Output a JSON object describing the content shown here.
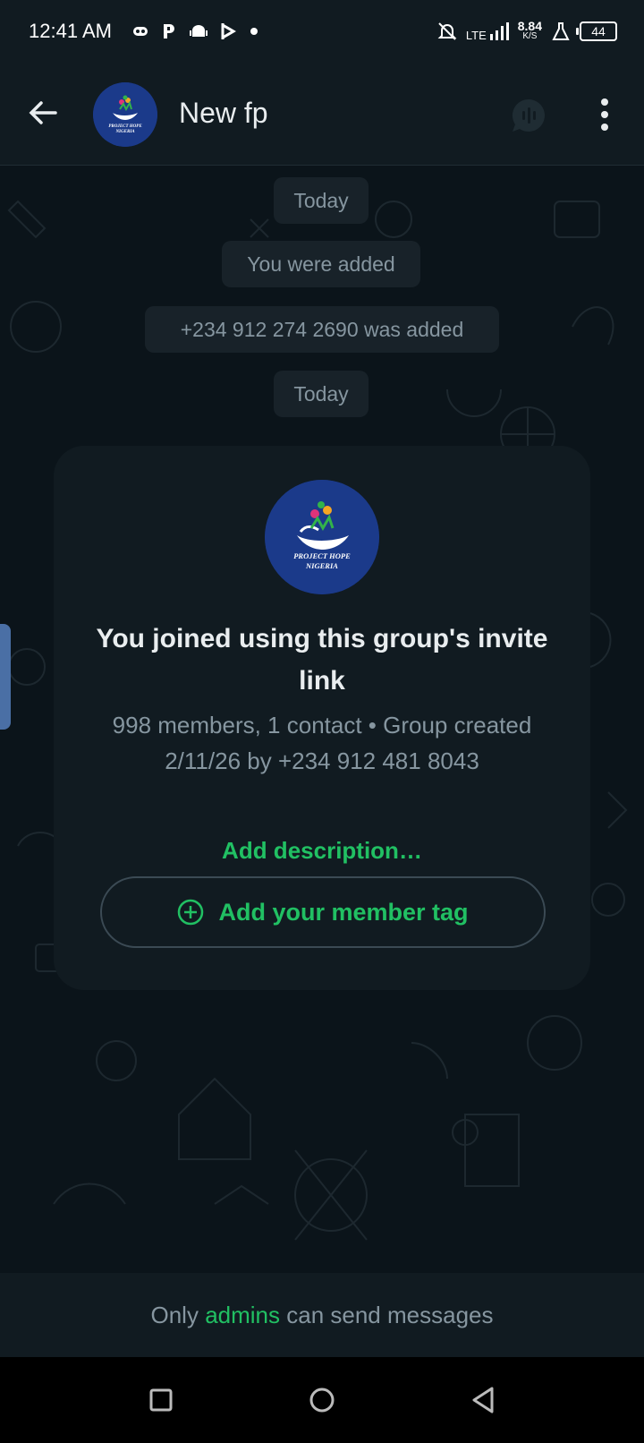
{
  "status_bar": {
    "time": "12:41 AM",
    "network_type": "LTE",
    "net_speed_value": "8.84",
    "net_speed_unit": "K/S",
    "battery": "44"
  },
  "header": {
    "title": "New fp",
    "avatar_text_line1": "PROJECT HOPE",
    "avatar_text_line2": "NIGERIA"
  },
  "messages": {
    "date_1": "Today",
    "system_1": "You were added",
    "system_2": "+234 912 274 2690 was added",
    "date_2": "Today"
  },
  "invite_card": {
    "avatar_text_line1": "PROJECT HOPE",
    "avatar_text_line2": "NIGERIA",
    "heading": "You joined using this group's invite link",
    "meta": "998 members, 1 contact • Group created 2/11/26 by +234 912 481 8043",
    "add_description": "Add description…",
    "member_tag_button": "Add your member tag"
  },
  "footer": {
    "prefix": "Only ",
    "highlight": "admins",
    "suffix": " can send messages"
  },
  "colors": {
    "accent": "#21c063",
    "background": "#0b141a",
    "surface": "#111b21",
    "muted_text": "#8696a0"
  }
}
